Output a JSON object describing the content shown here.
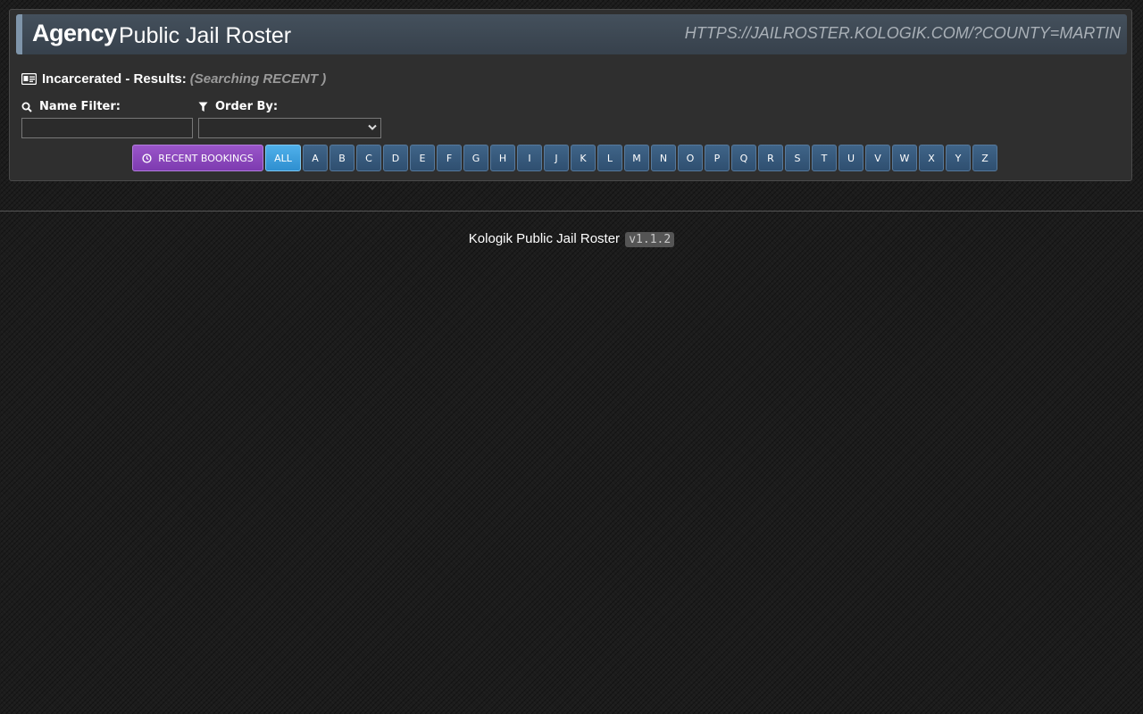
{
  "header": {
    "agency": "Agency",
    "title": "Public Jail Roster",
    "url": "HTTPS://JAILROSTER.KOLOGIK.COM/?COUNTY=MARTIN"
  },
  "results": {
    "icon": "id-card-icon",
    "label": "Incarcerated - Results:",
    "searching": "(Searching RECENT )"
  },
  "filters": {
    "name_label": "Name Filter:",
    "name_value": "",
    "name_icon": "search-icon",
    "order_label": "Order By:",
    "order_value": "",
    "order_icon": "filter-icon"
  },
  "buttons": {
    "recent_label": "RECENT BOOKINGS",
    "recent_icon": "clock-icon",
    "all_label": "ALL",
    "letters": [
      "A",
      "B",
      "C",
      "D",
      "E",
      "F",
      "G",
      "H",
      "I",
      "J",
      "K",
      "L",
      "M",
      "N",
      "O",
      "P",
      "Q",
      "R",
      "S",
      "T",
      "U",
      "V",
      "W",
      "X",
      "Y",
      "Z"
    ]
  },
  "footer": {
    "text": "Kologik Public Jail Roster",
    "version": "v1.1.2"
  },
  "colors": {
    "recent_button": "#8e48bf",
    "all_button": "#3fa0de",
    "letter_button": "#375a7c",
    "panel": "#2f2f2f"
  }
}
